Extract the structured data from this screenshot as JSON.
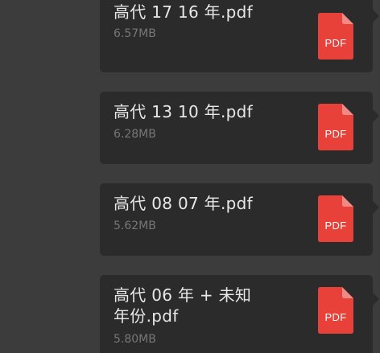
{
  "messages": [
    {
      "file_name": "高代 17 16 年.pdf",
      "file_size": "6.57MB",
      "icon_label": "PDF"
    },
    {
      "file_name": "高代 13 10 年.pdf",
      "file_size": "6.28MB",
      "icon_label": "PDF"
    },
    {
      "file_name": "高代 08 07 年.pdf",
      "file_size": "5.62MB",
      "icon_label": "PDF"
    },
    {
      "file_name": "高代 06 年 + 未知年份.pdf",
      "file_size": "5.80MB",
      "icon_label": "PDF"
    }
  ],
  "colors": {
    "background": "#3c3c3c",
    "bubble": "#2b2b2b",
    "pdf_red": "#e8413a",
    "pdf_fold": "#f08a85"
  },
  "icons": {
    "file_type": "pdf-file-icon"
  }
}
